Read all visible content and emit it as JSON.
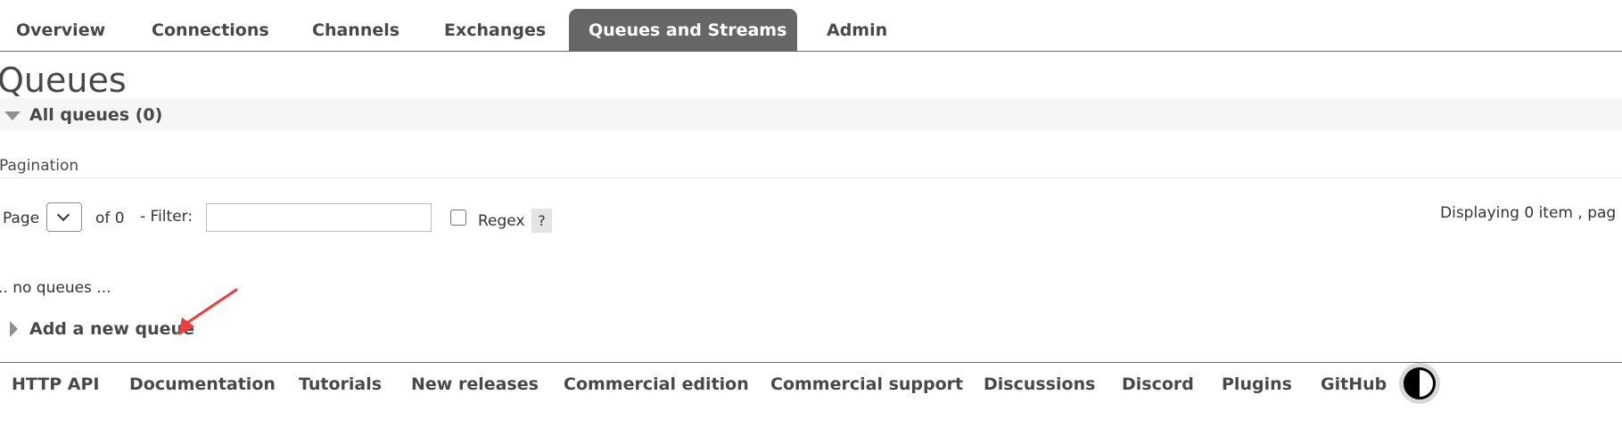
{
  "nav": {
    "tabs": [
      {
        "label": "Overview"
      },
      {
        "label": "Connections"
      },
      {
        "label": "Channels"
      },
      {
        "label": "Exchanges"
      },
      {
        "label": "Queues and Streams"
      },
      {
        "label": "Admin"
      }
    ],
    "active_tab": "Queues and Streams"
  },
  "page": {
    "title": "Queues",
    "section_label": "All queues (0)",
    "pagination_label": "Pagination",
    "page_label": "Page",
    "page_select_value": "",
    "of_pages": "of 0",
    "filter_label": "- Filter:",
    "filter_value": "",
    "regex_label": "Regex",
    "regex_checked": false,
    "help_label": "?",
    "displaying_text": "Displaying 0 item , pag",
    "empty_text": ".. no queues ...",
    "add_queue_label": "Add a new queue"
  },
  "footer": {
    "links": [
      {
        "label": "HTTP API"
      },
      {
        "label": "Documentation"
      },
      {
        "label": "Tutorials"
      },
      {
        "label": "New releases"
      },
      {
        "label": "Commercial edition"
      },
      {
        "label": "Commercial support"
      },
      {
        "label": "Discussions"
      },
      {
        "label": "Discord"
      },
      {
        "label": "Plugins"
      },
      {
        "label": "GitHub"
      }
    ],
    "theme_toggle_icon": "contrast-icon"
  },
  "colors": {
    "active_tab_bg": "#666666",
    "text": "#484848",
    "section_bg": "#f6f6f6",
    "annotation_arrow": "#f03c3c"
  }
}
